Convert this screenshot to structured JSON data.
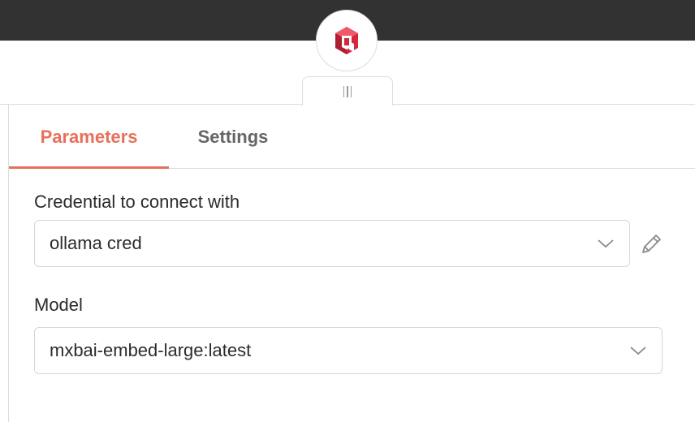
{
  "node": {
    "icon": "cube-hexagon-logo-icon",
    "accent": "#d5283d"
  },
  "tabs": [
    {
      "label": "Parameters",
      "active": true
    },
    {
      "label": "Settings",
      "active": false
    }
  ],
  "colors": {
    "active_tab": "#e8705b",
    "topbar": "#323232"
  },
  "fields": {
    "credential": {
      "label": "Credential to connect with",
      "value": "ollama cred"
    },
    "model": {
      "label": "Model",
      "value": "mxbai-embed-large:latest"
    }
  }
}
